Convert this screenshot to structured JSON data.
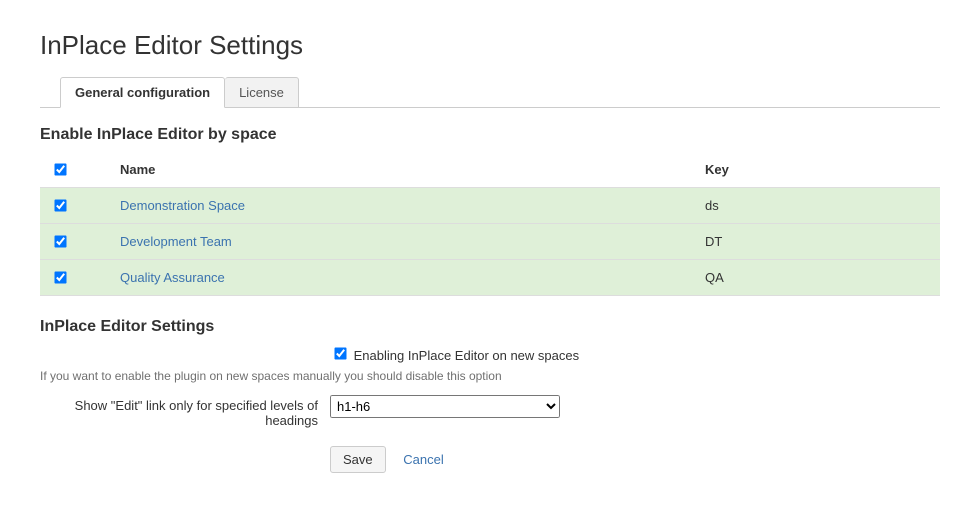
{
  "page_title": "InPlace Editor Settings",
  "tabs": [
    {
      "label": "General configuration",
      "active": true
    },
    {
      "label": "License",
      "active": false
    }
  ],
  "spaces_section": {
    "heading": "Enable InPlace Editor by space",
    "header_checkbox_checked": true,
    "columns": {
      "name": "Name",
      "key": "Key"
    },
    "rows": [
      {
        "checked": true,
        "name": "Demonstration Space",
        "key": "ds"
      },
      {
        "checked": true,
        "name": "Development Team",
        "key": "DT"
      },
      {
        "checked": true,
        "name": "Quality Assurance",
        "key": "QA"
      }
    ]
  },
  "settings_section": {
    "heading": "InPlace Editor Settings",
    "enable_new_spaces": {
      "checked": true,
      "label": "Enabling InPlace Editor on new spaces"
    },
    "helper_text": "If you want to enable the plugin on new spaces manually you should disable this option",
    "heading_levels": {
      "label": "Show \"Edit\" link only for specified levels of headings",
      "value": "h1-h6",
      "options": [
        "h1-h6"
      ]
    },
    "actions": {
      "save": "Save",
      "cancel": "Cancel"
    }
  }
}
